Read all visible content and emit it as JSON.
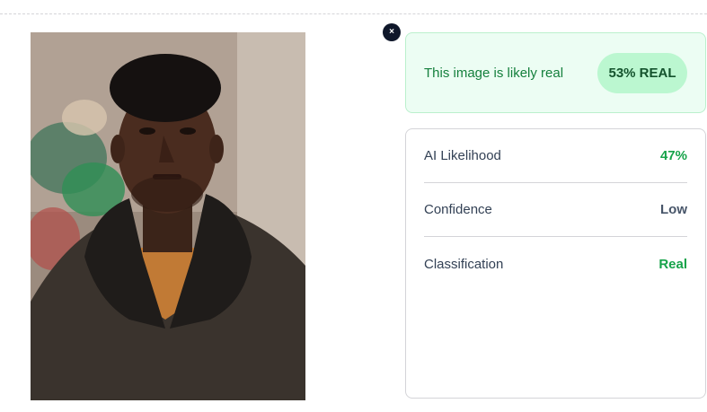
{
  "close": {
    "symbol": "×",
    "icon": "close-icon"
  },
  "result": {
    "message": "This image is likely real",
    "badge": "53% REAL",
    "color": "#15803d",
    "badge_background": "#bbf7d0"
  },
  "stats": [
    {
      "label": "AI Likelihood",
      "value": "47%",
      "tone": "green"
    },
    {
      "label": "Confidence",
      "value": "Low",
      "tone": "dark"
    },
    {
      "label": "Classification",
      "value": "Real",
      "tone": "green"
    }
  ],
  "photo": {
    "subject": "portrait of a man in a dark shearling coat over an orange sweater"
  }
}
